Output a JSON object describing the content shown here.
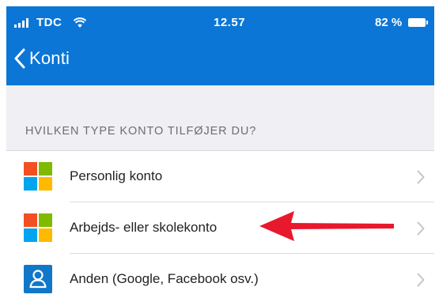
{
  "status_bar": {
    "carrier": "TDC",
    "time": "12.57",
    "battery_percent_label": "82 %",
    "battery_level": 0.82
  },
  "nav": {
    "back_label": "Konti"
  },
  "section": {
    "header": "HVILKEN TYPE KONTO TILFØJER DU?"
  },
  "rows": [
    {
      "label": "Personlig konto",
      "icon": "microsoft-logo-icon"
    },
    {
      "label": "Arbejds- eller skolekonto",
      "icon": "microsoft-logo-icon"
    },
    {
      "label": "Anden (Google, Facebook osv.)",
      "icon": "person-icon"
    }
  ],
  "colors": {
    "header_blue": "#0b76d6",
    "ms_red": "#f25022",
    "ms_green": "#7fba00",
    "ms_blue": "#00a4ef",
    "ms_yellow": "#ffb900",
    "arrow_red": "#e8192c",
    "person_tile": "#1178c9"
  }
}
